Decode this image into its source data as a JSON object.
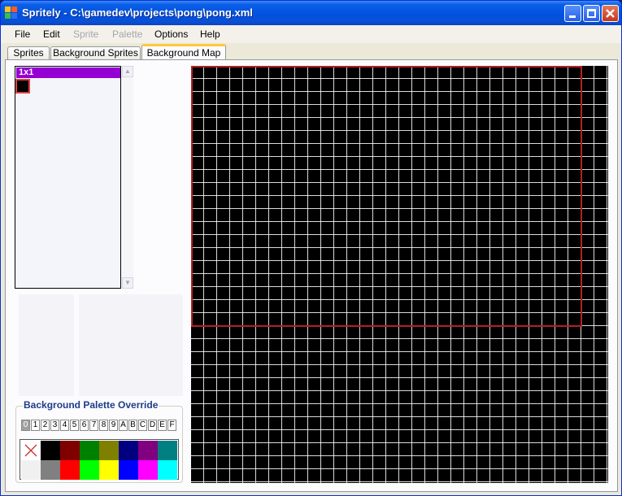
{
  "window": {
    "title": "Spritely - C:\\gamedev\\projects\\pong\\pong.xml"
  },
  "menu": [
    {
      "label": "File",
      "enabled": true
    },
    {
      "label": "Edit",
      "enabled": true
    },
    {
      "label": "Sprite",
      "enabled": false
    },
    {
      "label": "Palette",
      "enabled": false
    },
    {
      "label": "Options",
      "enabled": true
    },
    {
      "label": "Help",
      "enabled": true
    }
  ],
  "tabs": [
    {
      "label": "Sprites",
      "active": false
    },
    {
      "label": "Background Sprites",
      "active": false
    },
    {
      "label": "Background Map",
      "active": true
    }
  ],
  "sprite_list": {
    "group_label": "1x1"
  },
  "palette_override": {
    "title": "Background Palette Override",
    "palette_numbers": [
      "0",
      "1",
      "2",
      "3",
      "4",
      "5",
      "6",
      "7",
      "8",
      "9",
      "A",
      "B",
      "C",
      "D",
      "E",
      "F"
    ],
    "selected_palette": "0",
    "swatches_row1": [
      "transparent",
      "#000000",
      "#800000",
      "#008000",
      "#808000",
      "#000080",
      "#800080",
      "#008080"
    ],
    "swatches_row2": [
      "#f0f0f0",
      "#808080",
      "#ff0000",
      "#00ff00",
      "#ffff00",
      "#0000ff",
      "#ff00ff",
      "#00ffff"
    ]
  },
  "map": {
    "background_color": "#000000",
    "grid_color": "#ffffff",
    "viewport_color": "#b22222"
  }
}
